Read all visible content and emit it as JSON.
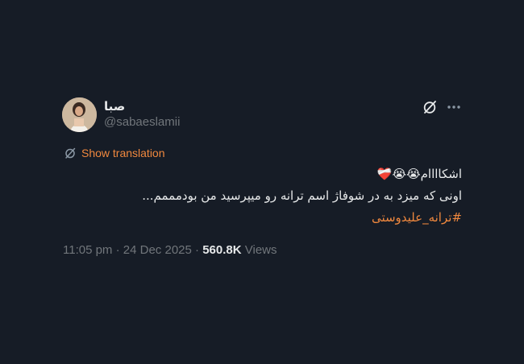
{
  "author": {
    "display_name": "صبا",
    "handle": "@sabaeslamii"
  },
  "icons": {
    "grok": "grok-icon",
    "more": "more-icon",
    "translate": "translate-icon"
  },
  "translation": {
    "label": "Show translation"
  },
  "tweet": {
    "line1_text": "اشکاااام",
    "line1_emojis": "😭😭❤️‍🩹",
    "line2_text": "اونی که میزد به در شوفاژ اسم ترانه رو میپرسید من بودمممم...",
    "hashtag": "#ترانه_علیدوستی"
  },
  "meta": {
    "time": "11:05 pm",
    "date": "24 Dec 2025",
    "views_count": "560.8K",
    "views_label": "Views"
  },
  "colors": {
    "background": "#161c26",
    "accent": "#f0883e",
    "text": "#e7e9ea",
    "muted": "#71767b"
  }
}
